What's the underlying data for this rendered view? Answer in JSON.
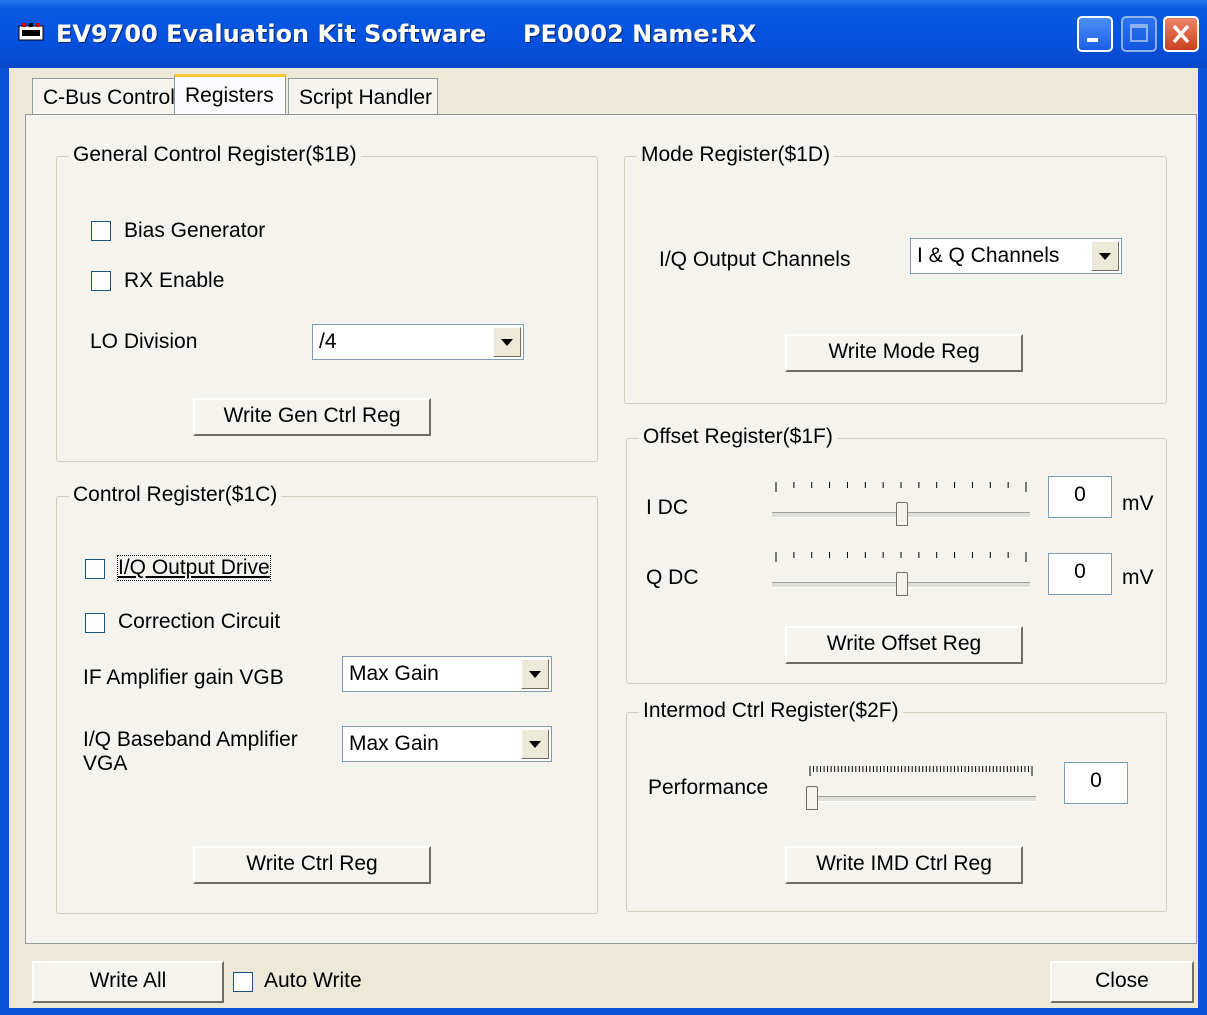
{
  "window": {
    "title": "EV9700 Evaluation Kit Software",
    "subtitle": "PE0002 Name:RX"
  },
  "tabs": [
    {
      "label": "C-Bus Control",
      "active": false
    },
    {
      "label": "Registers",
      "active": true
    },
    {
      "label": "Script Handler",
      "active": false
    }
  ],
  "gen_ctrl": {
    "title": "General Control Register($1B)",
    "bias_label": "Bias Generator",
    "rx_label": "RX Enable",
    "lo_label": "LO Division",
    "lo_value": "/4",
    "write_label": "Write Gen Ctrl Reg"
  },
  "ctrl": {
    "title": "Control Register($1C)",
    "iq_drive_label": "I/Q Output Drive",
    "correction_label": "Correction Circuit",
    "if_label": "IF Amplifier gain VGB",
    "if_value": "Max Gain",
    "iq_base_label_1": "I/Q Baseband Amplifier",
    "iq_base_label_2": "VGA",
    "iq_base_value": "Max Gain",
    "write_label": "Write Ctrl Reg"
  },
  "mode": {
    "title": "Mode Register($1D)",
    "channels_label": "I/Q Output Channels",
    "channels_value": "I & Q Channels",
    "write_label": "Write Mode Reg"
  },
  "offset": {
    "title": "Offset Register($1F)",
    "idc_label": "I DC",
    "idc_value": "0",
    "qdc_label": "Q DC",
    "qdc_value": "0",
    "unit": "mV",
    "idc_level": 0.5,
    "qdc_level": 0.5,
    "write_label": "Write Offset Reg"
  },
  "intermod": {
    "title": "Intermod Ctrl Register($2F)",
    "perf_label": "Performance",
    "perf_value": "0",
    "perf_level": 0,
    "write_label": "Write IMD Ctrl Reg"
  },
  "footer": {
    "write_all_label": "Write All",
    "auto_write_label": "Auto Write",
    "close_label": "Close"
  }
}
